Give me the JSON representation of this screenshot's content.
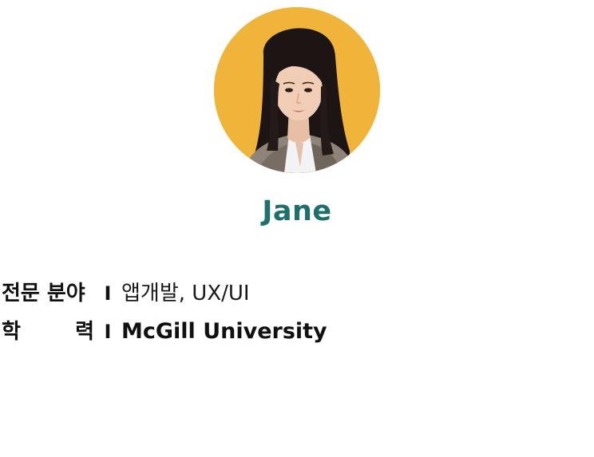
{
  "profile": {
    "name": "Jane",
    "photo_background": "#f0b43a",
    "name_color": "#1f6f6c"
  },
  "info": {
    "specialty": {
      "label": "전문 분야",
      "separator": "I",
      "value": "앱개발, UX/UI"
    },
    "education": {
      "label_first": "학",
      "label_last": "력",
      "separator": "I",
      "value": "McGill University"
    }
  }
}
